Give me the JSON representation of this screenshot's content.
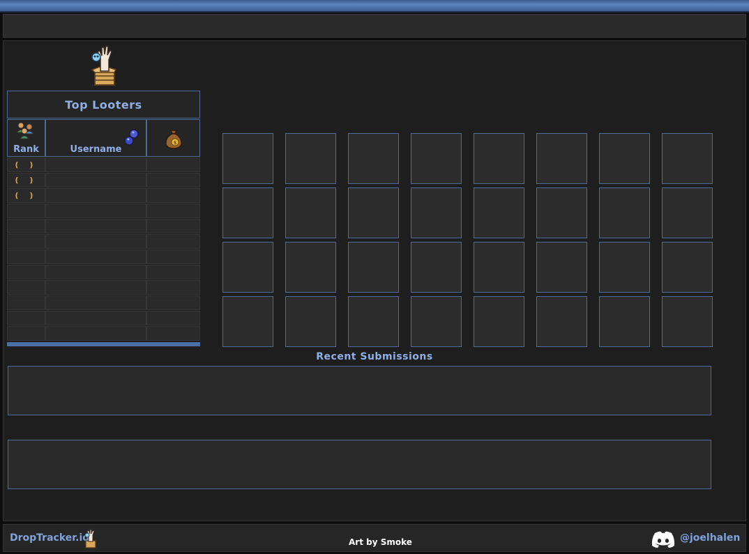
{
  "leaderboard": {
    "title": "Top Looters",
    "columns": {
      "rank": "Rank",
      "username": "Username"
    },
    "icons": {
      "rank": "players-icon",
      "username": "orbs-icon",
      "loot": "coin-bag-icon"
    },
    "rows": [
      {
        "rank": "( )",
        "username": "",
        "value": ""
      },
      {
        "rank": "( )",
        "username": "",
        "value": ""
      },
      {
        "rank": "( )",
        "username": "",
        "value": ""
      },
      {
        "rank": "",
        "username": "",
        "value": ""
      },
      {
        "rank": "",
        "username": "",
        "value": ""
      },
      {
        "rank": "",
        "username": "",
        "value": ""
      },
      {
        "rank": "",
        "username": "",
        "value": ""
      },
      {
        "rank": "",
        "username": "",
        "value": ""
      },
      {
        "rank": "",
        "username": "",
        "value": ""
      },
      {
        "rank": "",
        "username": "",
        "value": ""
      },
      {
        "rank": "",
        "username": "",
        "value": ""
      },
      {
        "rank": "",
        "username": "",
        "value": ""
      }
    ]
  },
  "item_grid": {
    "rows": 4,
    "columns": 8
  },
  "recent": {
    "title": "Recent Submissions"
  },
  "footer": {
    "site": "DropTracker.io",
    "credit": "Art by Smoke",
    "discord_handle": "@joelhalen",
    "icons": {
      "mascot": "loot-box-mascot-icon",
      "discord": "discord-icon"
    }
  },
  "colors": {
    "accent": "#4d6c99",
    "title_text": "#8fb0e6",
    "rank_bracket": "#d9a74a",
    "panel_bg": "#1e1e1e",
    "cell_bg": "#2a2a2a"
  }
}
